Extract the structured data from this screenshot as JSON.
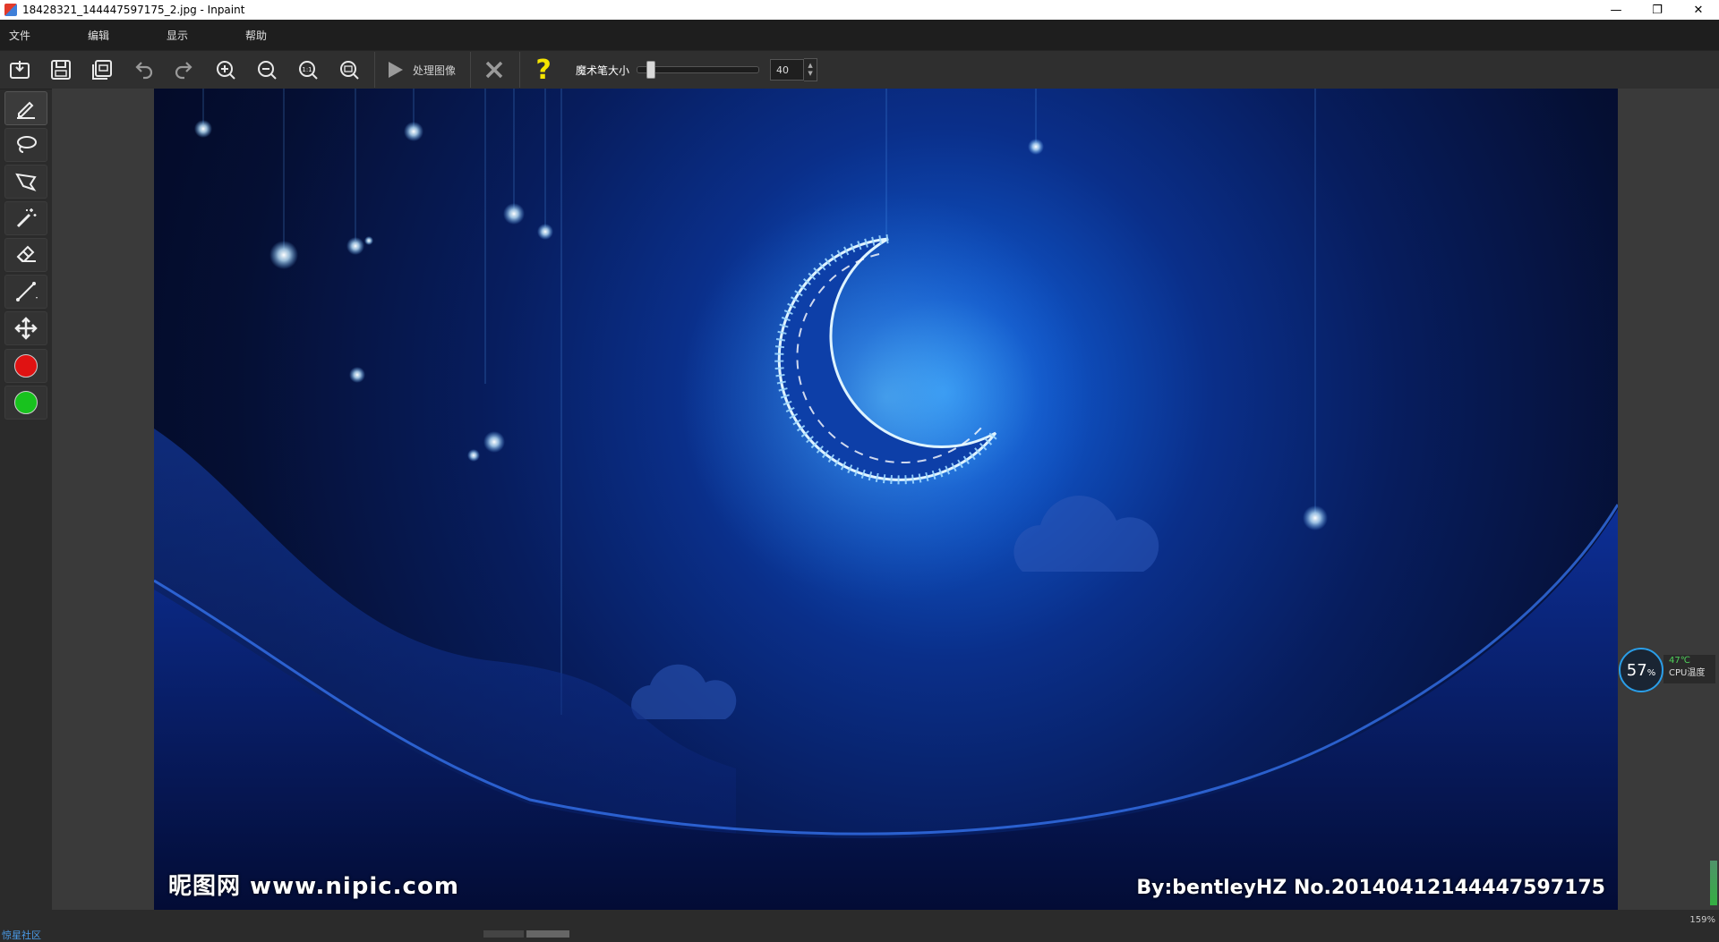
{
  "window": {
    "title": "18428321_144447597175_2.jpg - Inpaint",
    "min_glyph": "—",
    "restore_glyph": "❐",
    "close_glyph": "✕"
  },
  "menu": {
    "file": "文件",
    "edit": "编辑",
    "view": "显示",
    "help": "帮助"
  },
  "toolbar": {
    "process_label": "处理图像",
    "brush_size_label": "魔术笔大小",
    "brush_size_value": "40",
    "brush_size_fraction": 0.08,
    "help_glyph": "?"
  },
  "image": {
    "watermark_left": "昵图网 www.nipic.com",
    "watermark_right": "By:bentleyHZ No.20140412144447597175"
  },
  "cpu_widget": {
    "usage": "57",
    "usage_unit": "%",
    "temperature": "47℃",
    "label": "CPU温度"
  },
  "status": {
    "zoom": "159%",
    "left_link": "惊星社区"
  },
  "colors": {
    "red_marker": "#e01212",
    "green_marker": "#18c21e"
  }
}
